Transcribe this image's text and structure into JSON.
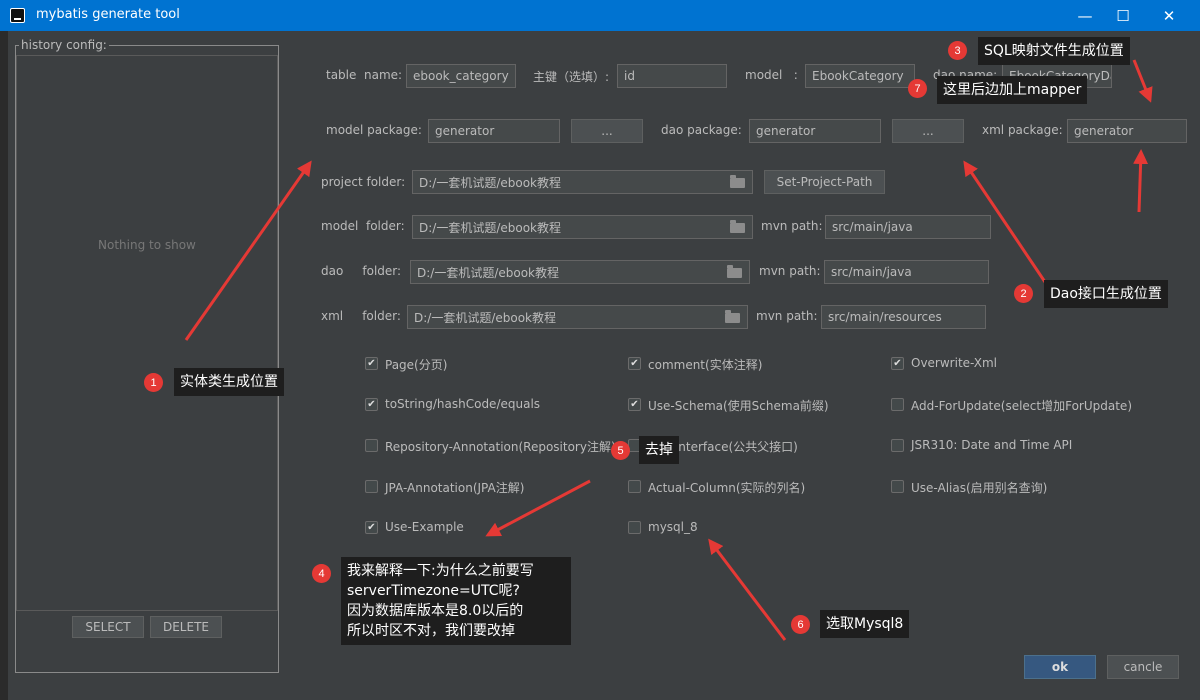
{
  "window": {
    "title": "mybatis generate tool",
    "minimize": "—",
    "maximize": "☐",
    "close": "✕"
  },
  "history": {
    "label": "history config:",
    "empty": "Nothing to show",
    "select": "SELECT",
    "delete": "DELETE"
  },
  "row1": {
    "table_label": "table  name:",
    "table_value": "ebook_category",
    "key_label": "主键（选填）:",
    "key_value": "id",
    "model_label": "model   :",
    "model_value": "EbookCategory",
    "dao_label": "dao name:",
    "dao_value": "EbookCategoryDao"
  },
  "row2": {
    "model_pkg_label": "model package:",
    "model_pkg_value": "generator",
    "browse1": "...",
    "dao_pkg_label": "dao package:",
    "dao_pkg_value": "generator",
    "browse2": "...",
    "xml_pkg_label": "xml package:",
    "xml_pkg_value": "generator"
  },
  "project": {
    "label": "project folder:",
    "value": "D:/一套机试题/ebook教程",
    "set_path": "Set-Project-Path"
  },
  "model_folder": {
    "label": "model  folder:",
    "value": "D:/一套机试题/ebook教程",
    "mvn_label": "mvn path:",
    "mvn_value": "src/main/java"
  },
  "dao_folder": {
    "label": "dao     folder:",
    "value": "D:/一套机试题/ebook教程",
    "mvn_label": "mvn path:",
    "mvn_value": "src/main/java"
  },
  "xml_folder": {
    "label": "xml     folder:",
    "value": "D:/一套机试题/ebook教程",
    "mvn_label": "mvn path:",
    "mvn_value": "src/main/resources"
  },
  "options": [
    {
      "label": "Page(分页)",
      "checked": true
    },
    {
      "label": "comment(实体注释)",
      "checked": true
    },
    {
      "label": "Overwrite-Xml",
      "checked": true
    },
    {
      "label": "toString/hashCode/equals",
      "checked": true
    },
    {
      "label": "Use-Schema(使用Schema前缀)",
      "checked": true
    },
    {
      "label": "Add-ForUpdate(select增加ForUpdate)",
      "checked": false
    },
    {
      "label": "Repository-Annotation(Repository注解)",
      "checked": false
    },
    {
      "label": "Use-Interface(公共父接口)",
      "checked": false
    },
    {
      "label": "JSR310: Date and Time API",
      "checked": false
    },
    {
      "label": "JPA-Annotation(JPA注解)",
      "checked": false
    },
    {
      "label": "Actual-Column(实际的列名)",
      "checked": false
    },
    {
      "label": "Use-Alias(启用别名查询)",
      "checked": false
    },
    {
      "label": "Use-Example",
      "checked": true
    },
    {
      "label": "mysql_8",
      "checked": false
    }
  ],
  "footer": {
    "ok": "ok",
    "cancel": "cancle"
  },
  "annotations": {
    "a1": {
      "num": "1",
      "text": "实体类生成位置"
    },
    "a2": {
      "num": "2",
      "text": "Dao接口生成位置"
    },
    "a3": {
      "num": "3",
      "text": "SQL映射文件生成位置"
    },
    "a4": {
      "num": "4",
      "line1": "我来解释一下:为什么之前要写",
      "line2": "serverTimezone=UTC呢?",
      "line3": "因为数据库版本是8.0以后的",
      "line4": "所以时区不对，我们要改掉"
    },
    "a5": {
      "num": "5",
      "text": "去掉"
    },
    "a6": {
      "num": "6",
      "text": "选取Mysql8"
    },
    "a7": {
      "num": "7",
      "text": "这里后边加上mapper"
    }
  },
  "colors": {
    "titlebar": "#0073d1",
    "background": "#3c3f41",
    "annotation": "#e53935"
  }
}
